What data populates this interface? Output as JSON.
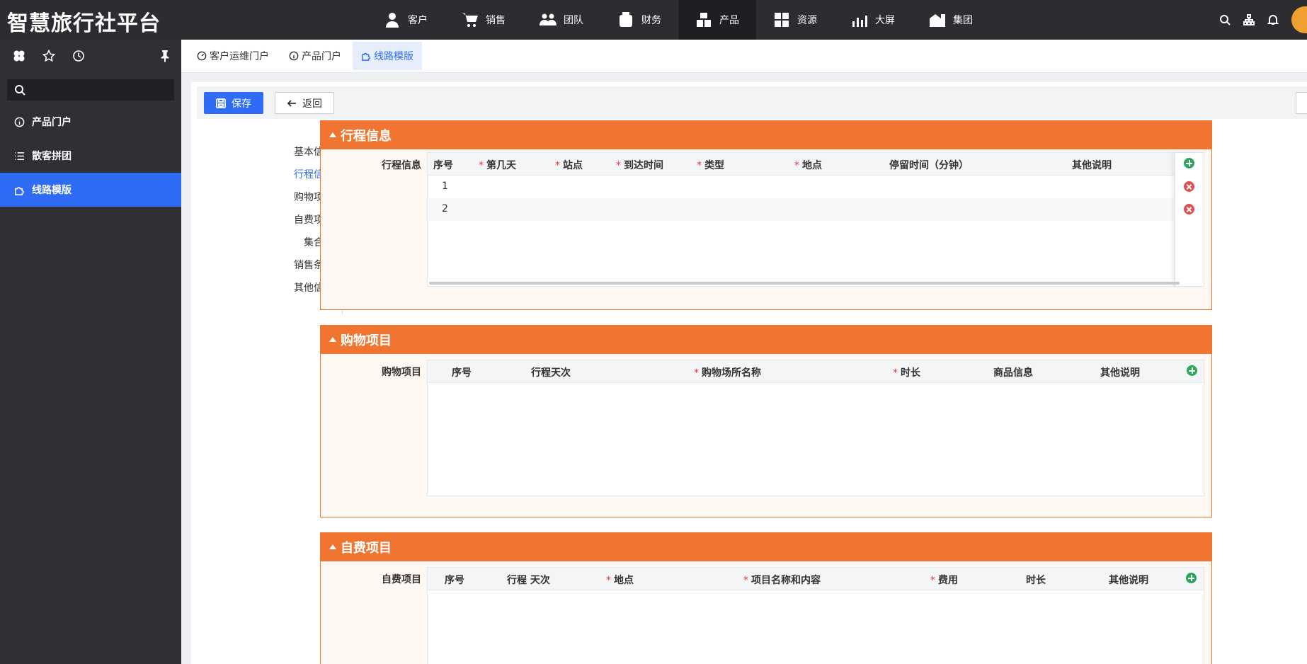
{
  "app": {
    "title": "智慧旅行社平台"
  },
  "topnav": [
    {
      "label": "客户",
      "icon": "customer-icon"
    },
    {
      "label": "销售",
      "icon": "cart-icon"
    },
    {
      "label": "团队",
      "icon": "team-icon"
    },
    {
      "label": "财务",
      "icon": "finance-icon"
    },
    {
      "label": "产品",
      "icon": "product-icon",
      "active": true
    },
    {
      "label": "资源",
      "icon": "resource-icon"
    },
    {
      "label": "大屏",
      "icon": "chart-screen-icon"
    },
    {
      "label": "集团",
      "icon": "group-icon"
    }
  ],
  "sidebar": {
    "search_placeholder": "",
    "items": [
      {
        "label": "产品门户",
        "icon": "info-icon"
      },
      {
        "label": "散客拼团",
        "icon": "list-icon"
      },
      {
        "label": "线路模版",
        "icon": "puzzle-icon",
        "active": true
      }
    ]
  },
  "tabs": [
    {
      "label": "客户运维门户",
      "icon": "dashboard-icon"
    },
    {
      "label": "产品门户",
      "icon": "info-icon"
    },
    {
      "label": "线路模版",
      "icon": "puzzle-icon",
      "active": true
    }
  ],
  "toolbar": {
    "save_label": "保存",
    "back_label": "返回"
  },
  "anchors": [
    "基本信息",
    "行程信息",
    "购物项目",
    "自费项目",
    "集合点",
    "销售条款",
    "其他信息"
  ],
  "anchor_active": "行程信息",
  "itinerary": {
    "title": "行程信息",
    "row_label": "行程信息",
    "columns": [
      {
        "label": "序号",
        "required": false
      },
      {
        "label": "第几天",
        "required": true
      },
      {
        "label": "站点",
        "required": true
      },
      {
        "label": "到达时间",
        "required": true
      },
      {
        "label": "类型",
        "required": true
      },
      {
        "label": "地点",
        "required": true
      },
      {
        "label": "停留时间（分钟）",
        "required": false
      },
      {
        "label": "其他说明",
        "required": false
      }
    ],
    "rows": [
      "1",
      "2"
    ]
  },
  "shopping": {
    "title": "购物项目",
    "row_label": "购物项目",
    "columns": [
      {
        "label": "序号",
        "required": false
      },
      {
        "label": "行程天次",
        "required": false
      },
      {
        "label": "购物场所名称",
        "required": true
      },
      {
        "label": "时长",
        "required": true
      },
      {
        "label": "商品信息",
        "required": false
      },
      {
        "label": "其他说明",
        "required": false
      }
    ]
  },
  "optional": {
    "title": "自费项目",
    "row_label": "自费项目",
    "columns": [
      {
        "label": "序号",
        "required": false
      },
      {
        "label": "行程 天次",
        "required": false
      },
      {
        "label": "地点",
        "required": true
      },
      {
        "label": "项目名称和内容",
        "required": true
      },
      {
        "label": "费用",
        "required": true
      },
      {
        "label": "时长",
        "required": false
      },
      {
        "label": "其他说明",
        "required": false
      }
    ]
  },
  "colors": {
    "topbar": "#2b2d31",
    "sidebar": "#2e3035",
    "accent": "#2e6cf6",
    "section": "#f07530",
    "section_bg": "#fff7f2"
  }
}
